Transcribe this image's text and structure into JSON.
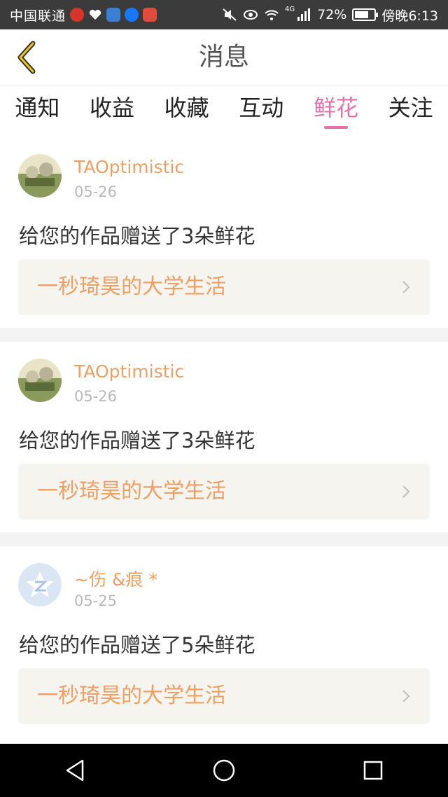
{
  "status_bar": {
    "carrier": "中国联通",
    "battery_percent": "72%",
    "time": "傍晚6:13",
    "network": "4G",
    "battery_level": 0.72,
    "icons": [
      "weibo-icon",
      "health-heart-icon",
      "wallet-icon",
      "alipay-icon",
      "special-app-icon",
      "mute-icon",
      "eye-icon",
      "wifi-icon",
      "signal-icon",
      "battery-icon"
    ]
  },
  "header": {
    "title": "消息",
    "back_icon": "chevron-left-icon"
  },
  "tabs": [
    {
      "label": "通知",
      "active": false
    },
    {
      "label": "收益",
      "active": false
    },
    {
      "label": "收藏",
      "active": false
    },
    {
      "label": "互动",
      "active": false
    },
    {
      "label": "鲜花",
      "active": true
    },
    {
      "label": "关注",
      "active": false
    }
  ],
  "messages": [
    {
      "user": "TAOptimistic",
      "date": "05-26",
      "text": "给您的作品赠送了3朵鲜花",
      "work_title": "一秒琦昊的大学生活",
      "avatar": "photo-avatar"
    },
    {
      "user": "TAOptimistic",
      "date": "05-26",
      "text": "给您的作品赠送了3朵鲜花",
      "work_title": "一秒琦昊的大学生活",
      "avatar": "photo-avatar"
    },
    {
      "user": "~伤 &痕 *",
      "date": "05-25",
      "text": "给您的作品赠送了5朵鲜花",
      "work_title": "一秒琦昊的大学生活",
      "avatar": "qq-default-avatar"
    }
  ],
  "colors": {
    "accent": "#e272a8",
    "username": "#ee9f63",
    "work_box_bg": "#f6f4ee",
    "status_bar_bg": "#3b3b3b",
    "nav_bar_bg": "#000000"
  }
}
